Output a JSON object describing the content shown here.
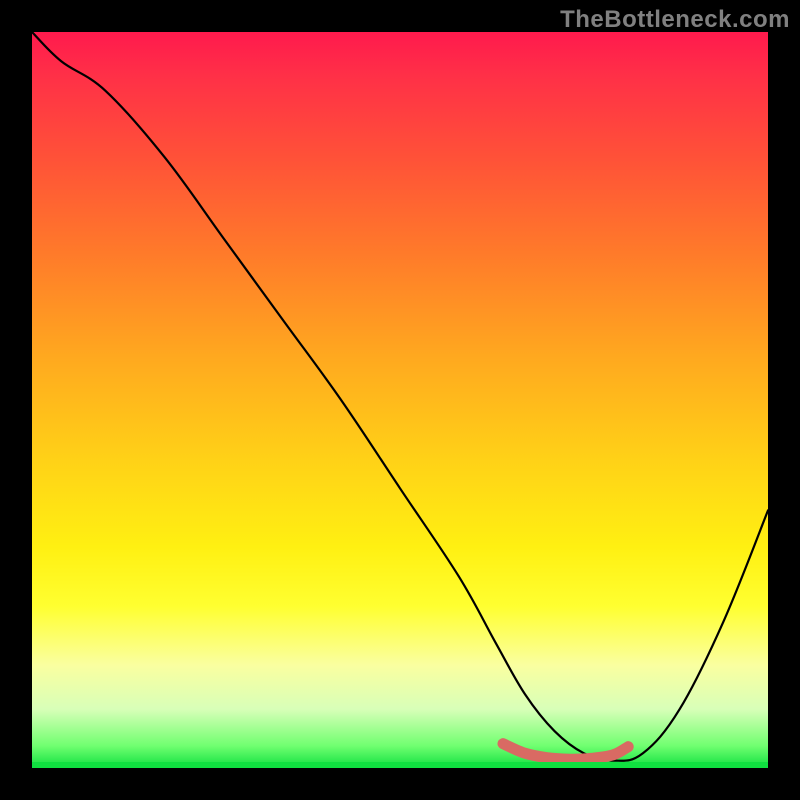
{
  "watermark": "TheBottleneck.com",
  "colors": {
    "background": "#000000",
    "curve": "#000000",
    "annotation": "#d96a63"
  },
  "chart_data": {
    "type": "line",
    "title": "",
    "xlabel": "",
    "ylabel": "",
    "xlim": [
      0,
      100
    ],
    "ylim": [
      0,
      100
    ],
    "grid": false,
    "legend": false,
    "series": [
      {
        "name": "bottleneck-curve",
        "x": [
          0,
          4,
          10,
          18,
          26,
          34,
          42,
          50,
          58,
          63,
          67,
          71,
          75,
          79,
          83,
          88,
          94,
          100
        ],
        "y": [
          100,
          96,
          92,
          83,
          72,
          61,
          50,
          38,
          26,
          17,
          10,
          5,
          2,
          1,
          2,
          8,
          20,
          35
        ]
      }
    ],
    "annotation": {
      "name": "curve-minimum-highlight",
      "x": [
        64,
        67,
        70,
        73,
        76,
        79,
        81
      ],
      "y": [
        3.3,
        2.0,
        1.4,
        1.2,
        1.3,
        1.8,
        2.9
      ]
    },
    "gradient_stops": [
      {
        "pos": 0,
        "color": "#ff1a4d"
      },
      {
        "pos": 30,
        "color": "#ff7a2a"
      },
      {
        "pos": 58,
        "color": "#ffd117"
      },
      {
        "pos": 78,
        "color": "#ffff30"
      },
      {
        "pos": 100,
        "color": "#10e040"
      }
    ]
  }
}
